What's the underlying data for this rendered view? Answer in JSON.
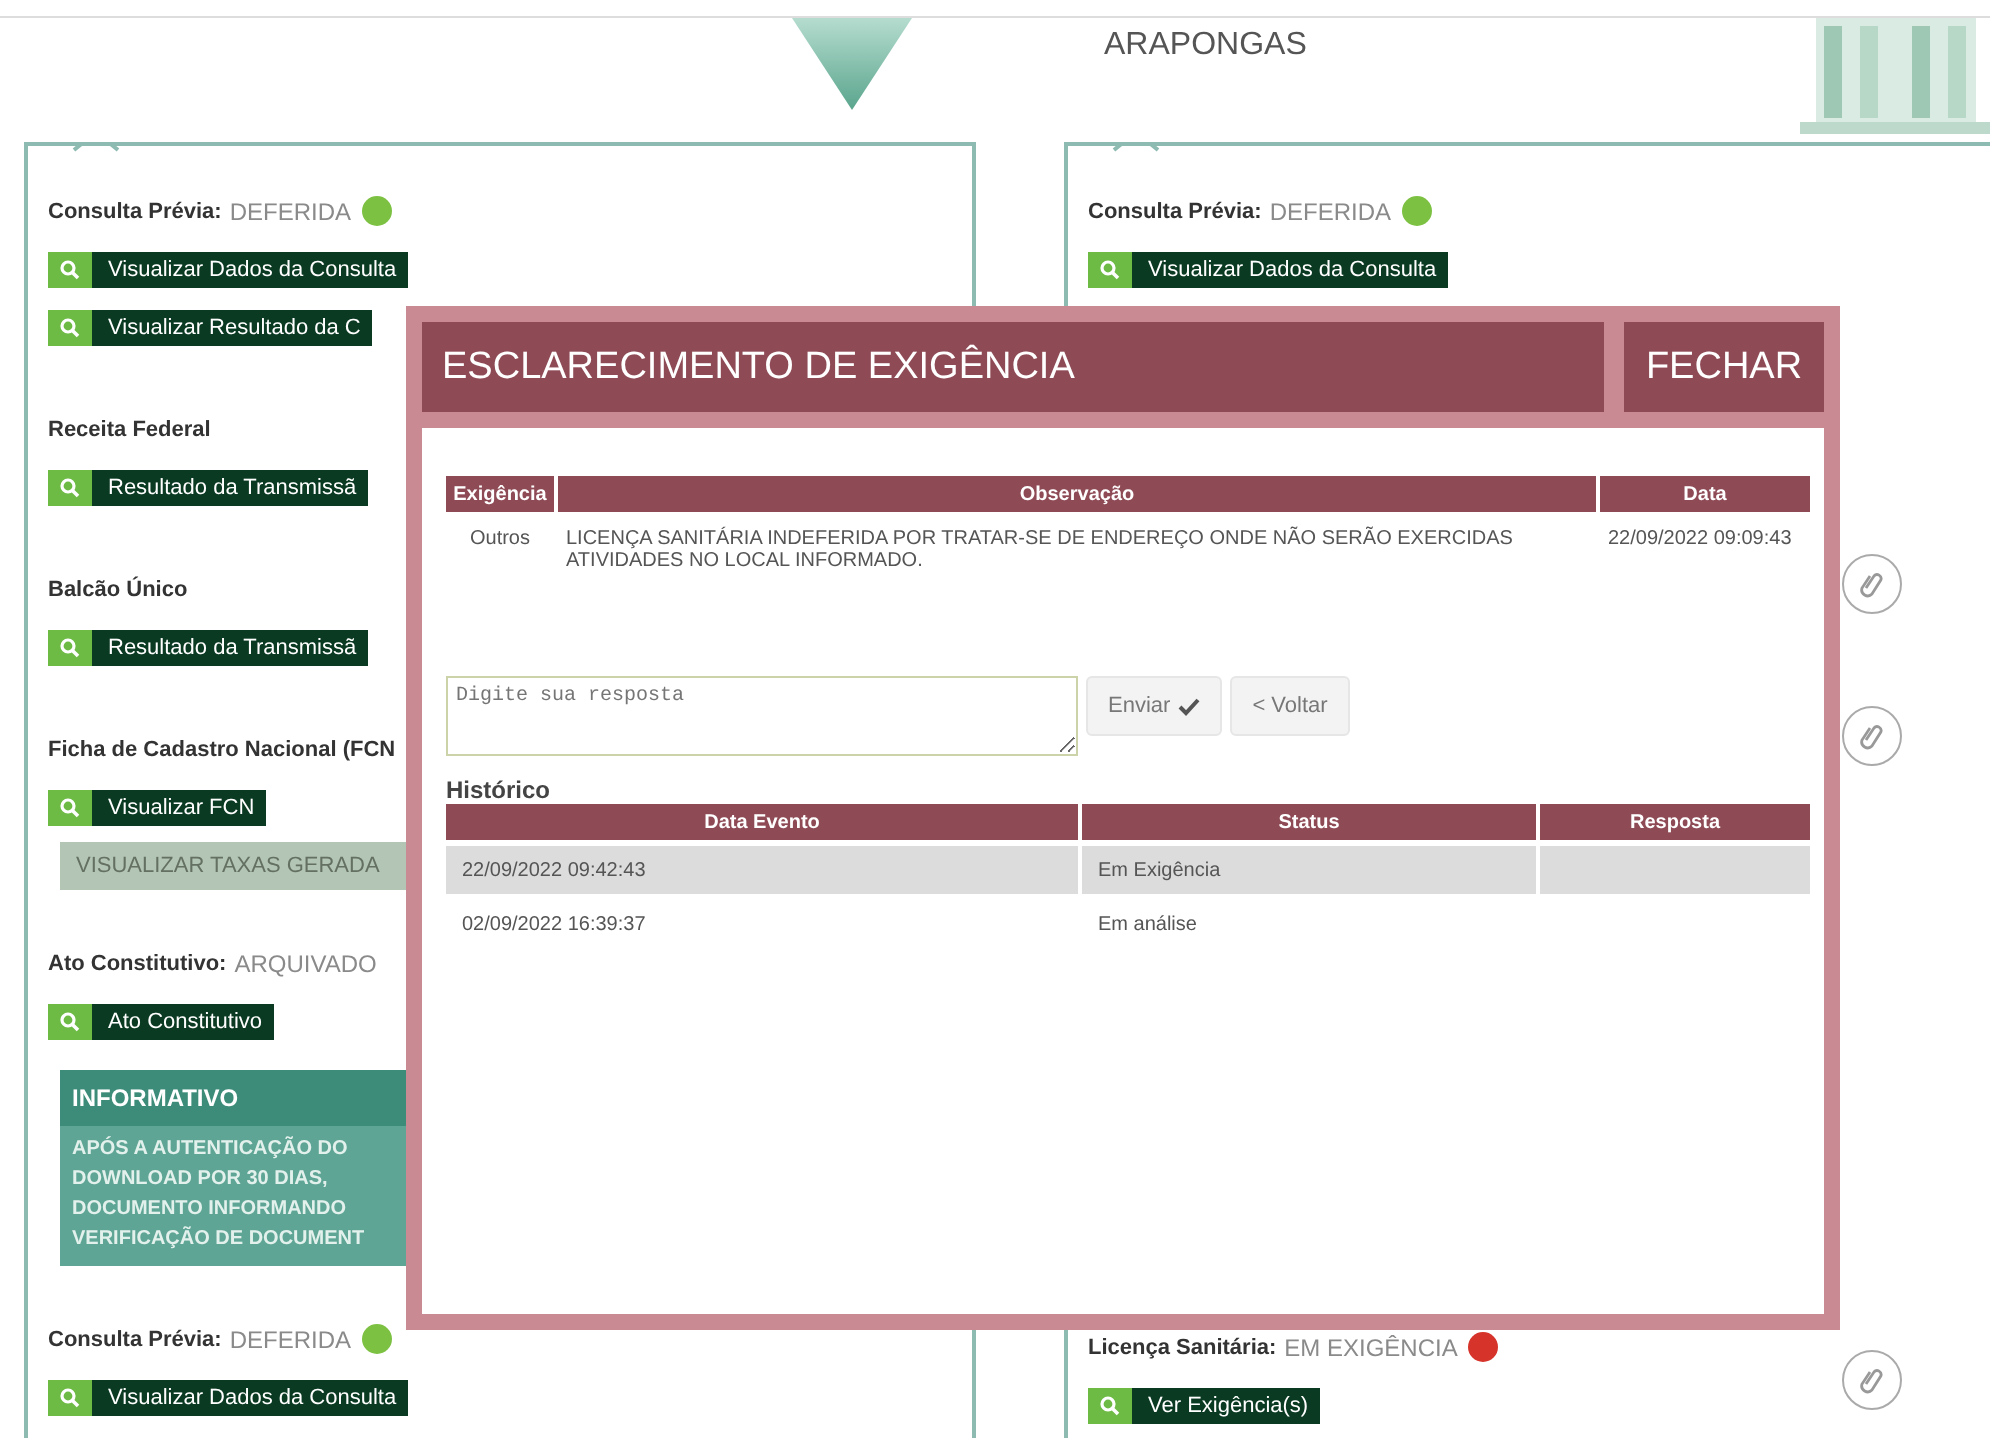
{
  "header": {
    "city": "ARAPONGAS"
  },
  "left_panel": {
    "sections": [
      {
        "items": [
          {
            "kind": "status",
            "label": "Consulta Prévia:",
            "value": "DEFERIDA",
            "color": "#7dc143"
          },
          {
            "kind": "button",
            "label": "Visualizar Dados da Consulta"
          },
          {
            "kind": "button",
            "label": "Visualizar Resultado da C"
          }
        ]
      },
      {
        "items": [
          {
            "kind": "heading",
            "label": "Receita Federal"
          },
          {
            "kind": "button",
            "label": "Resultado da Transmissã"
          }
        ]
      },
      {
        "items": [
          {
            "kind": "heading",
            "label": "Balcão Único"
          },
          {
            "kind": "button",
            "label": "Resultado da Transmissã"
          }
        ]
      },
      {
        "items": [
          {
            "kind": "heading",
            "label": "Ficha de Cadastro Nacional (FCN"
          },
          {
            "kind": "button",
            "label": "Visualizar FCN"
          },
          {
            "kind": "wide_button",
            "label": "VISUALIZAR TAXAS GERADA"
          }
        ]
      },
      {
        "items": [
          {
            "kind": "status",
            "label": "Ato Constitutivo:",
            "value": "ARQUIVADO"
          },
          {
            "kind": "button",
            "label": "Ato Constitutivo"
          },
          {
            "kind": "notice",
            "title": "INFORMATIVO",
            "lines": [
              "APÓS A AUTENTICAÇÃO DO",
              "DOWNLOAD POR 30 DIAS,",
              "DOCUMENTO INFORMANDO",
              "VERIFICAÇÃO DE DOCUMENT"
            ]
          }
        ]
      },
      {
        "items": [
          {
            "kind": "status",
            "label": "Consulta Prévia:",
            "value": "DEFERIDA",
            "color": "#7dc143"
          },
          {
            "kind": "button",
            "label": "Visualizar Dados da Consulta"
          }
        ]
      }
    ]
  },
  "right_panel": {
    "top": [
      {
        "kind": "status",
        "label": "Consulta Prévia:",
        "value": "DEFERIDA",
        "color": "#7dc143"
      },
      {
        "kind": "button",
        "label": "Visualizar Dados da Consulta"
      }
    ],
    "bottom": [
      {
        "kind": "status",
        "label": "Licença Sanitária:",
        "value": "EM EXIGÊNCIA",
        "color": "#d6332a"
      },
      {
        "kind": "button",
        "label": "Ver Exigência(s)"
      }
    ]
  },
  "dialog": {
    "title": "ESCLARECIMENTO DE EXIGÊNCIA",
    "close": "FECHAR",
    "requirements": {
      "columns": [
        "Exigência",
        "Observação",
        "Data"
      ],
      "rows": [
        {
          "cells": [
            "Outros",
            "LICENÇA SANITÁRIA INDEFERIDA POR TRATAR-SE DE ENDEREÇO ONDE NÃO SERÃO EXERCIDAS ATIVIDADES NO LOCAL INFORMADO.",
            "22/09/2022 09:09:43"
          ]
        }
      ]
    },
    "reply": {
      "placeholder": "Digite sua resposta"
    },
    "buttons": [
      {
        "kind": "send",
        "label": "Enviar"
      },
      {
        "kind": "back",
        "label": "< Voltar"
      }
    ],
    "history": {
      "title": "Histórico",
      "columns": [
        "Data Evento",
        "Status",
        "Resposta"
      ],
      "rows": [
        {
          "date": "22/09/2022 09:42:43",
          "status": "Em Exigência",
          "selected": true
        },
        {
          "date": "02/09/2022 16:39:37",
          "status": "Em análise",
          "selected": false
        }
      ]
    }
  }
}
